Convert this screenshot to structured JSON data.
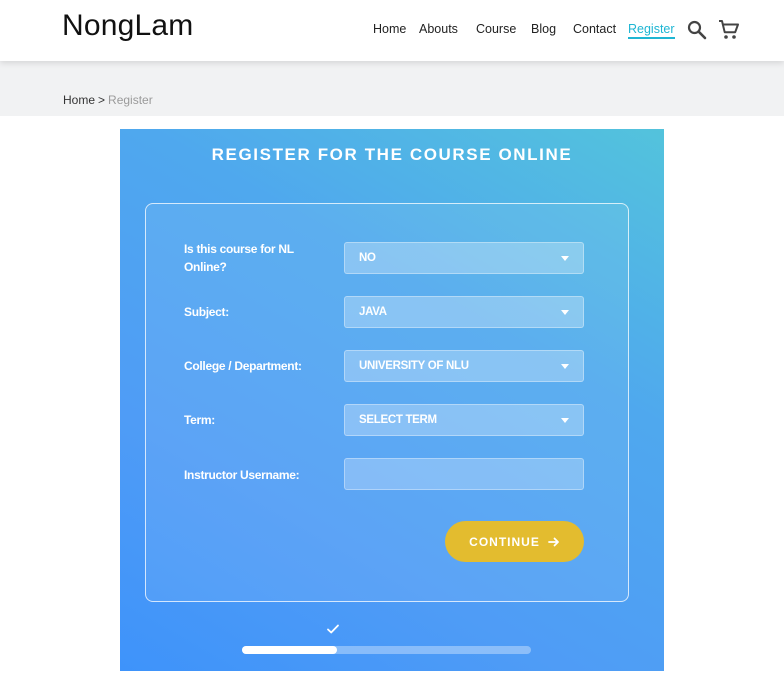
{
  "header": {
    "brand": "NongLam",
    "nav": [
      {
        "label": "Home"
      },
      {
        "label": "Abouts"
      },
      {
        "label": "Course"
      },
      {
        "label": "Blog"
      },
      {
        "label": "Contact"
      },
      {
        "label": "Register",
        "active": true
      }
    ],
    "icons": {
      "search": "search-icon",
      "cart": "cart-icon"
    },
    "accent_color": "#1fb6d3"
  },
  "breadcrumb": {
    "home": "Home",
    "separator": ">",
    "current": "Register"
  },
  "panel": {
    "title": "REGISTER FOR THE COURSE ONLINE",
    "fields": {
      "nl_online": {
        "label": "Is this course for NL Online?",
        "value": "NO"
      },
      "subject": {
        "label": "Subject:",
        "value": "JAVA"
      },
      "college": {
        "label": "College / Department:",
        "value": "UNIVERSITY OF NLU"
      },
      "term": {
        "label": "Term:",
        "value": "SELECT TERM"
      },
      "instructor": {
        "label": "Instructor Username:",
        "value": ""
      }
    },
    "continue_label": "CONTINUE",
    "continue_color": "#e3bc2f",
    "progress_fraction": 0.33
  }
}
